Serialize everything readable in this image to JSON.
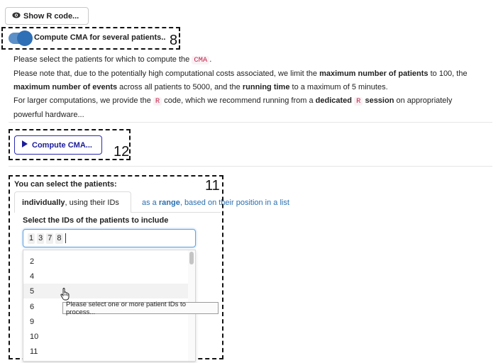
{
  "show_code_button": {
    "label": "Show R code...",
    "icon": "eye-icon"
  },
  "cma_toggle": {
    "label": "Compute CMA for several patients..",
    "on": true
  },
  "description": {
    "line1_a": "Please select the patients for which to compute the",
    "line1_code": "CMA",
    "line1_b": ".",
    "line2_a": "Please note that, due to the potentially high computational costs associated, we limit the",
    "line2_b1": "maximum number of patients",
    "line2_c": "to 100, the",
    "line3_b": "maximum number of events",
    "line3_c": "across all patients to 5000, and the",
    "line3_d": "running time",
    "line3_e": "to a maximum of 5 minutes.",
    "line4_a": "For larger computations, we provide the",
    "line4_code": "R",
    "line4_b": "code, which we recommend running from a",
    "line4_bold": "dedicated",
    "line4_code2": "R",
    "line4_bold2": "session",
    "line4_c": "on appropriately",
    "line5": "powerful hardware..."
  },
  "compute_button": {
    "label": "Compute CMA...",
    "icon": "play-icon"
  },
  "patients_section": {
    "heading": "You can select the patients:",
    "tab_individually_bold": "individually",
    "tab_individually_rest": ", using their IDs",
    "tab_range_a": "as a",
    "tab_range_bold": "range",
    "tab_range_b": ", based on their position in a list",
    "select_label": "Select the IDs of the patients to include",
    "selected_ids": [
      "1",
      "3",
      "7",
      "8"
    ],
    "options": [
      "2",
      "4",
      "5",
      "6",
      "9",
      "10",
      "11"
    ],
    "hovered_option": "5",
    "tooltip": "Please select one or more patient IDs to process..."
  },
  "annotations": [
    "8",
    "12",
    "11"
  ]
}
